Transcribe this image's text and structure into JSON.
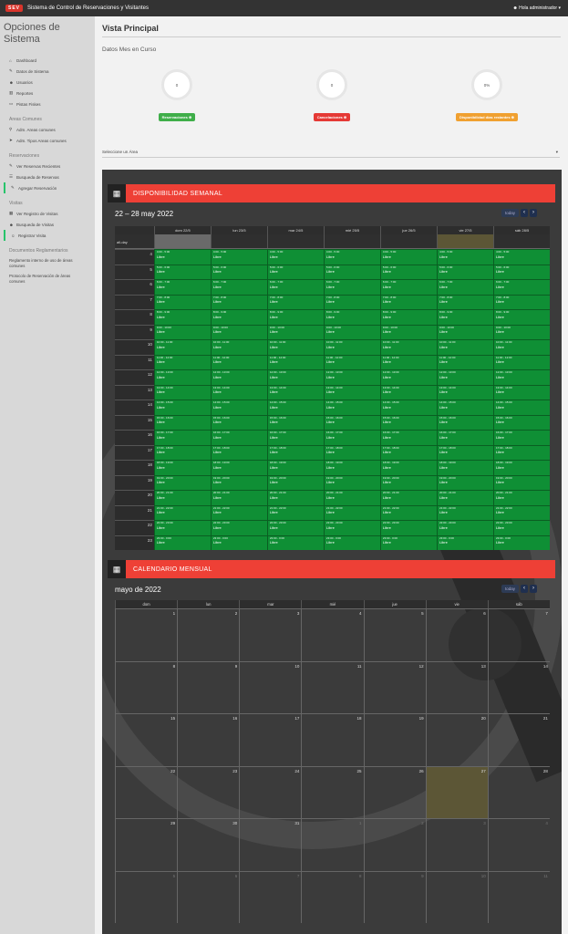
{
  "navbar": {
    "logo": "SEV",
    "title": "Sistema de Control de Reservaciones y Visitantes",
    "user": "Hola administrador ▾"
  },
  "sidebar": {
    "title": "Opciones de Sistema",
    "items": [
      {
        "icon": "home-icon",
        "glyph": "⌂",
        "label": "Dashboard"
      },
      {
        "icon": "edit-icon",
        "glyph": "✎",
        "label": "Datos de Sistema"
      },
      {
        "icon": "users-icon",
        "glyph": "☻",
        "label": "Usuarios"
      },
      {
        "icon": "chart-icon",
        "glyph": "▥",
        "label": "Reportes"
      },
      {
        "icon": "tv-icon",
        "glyph": "▭",
        "label": "Pistas Fiskes"
      }
    ],
    "sections": [
      {
        "title": "Areas Comunes",
        "items": [
          {
            "icon": "pin-icon",
            "glyph": "⚲",
            "label": "Adm. Areas comunes"
          },
          {
            "icon": "arrow-icon",
            "glyph": "➤",
            "label": "Adm. Tipos Areas comunes"
          }
        ]
      },
      {
        "title": "Reservaciones",
        "items": [
          {
            "icon": "edit-icon",
            "glyph": "✎",
            "label": "Ver Reservas Recientes"
          },
          {
            "icon": "list-icon",
            "glyph": "☰",
            "label": "Busqueda de Reservas"
          },
          {
            "icon": "edit-icon",
            "glyph": "✎",
            "label": "Agregar Reservación",
            "active": true
          }
        ]
      },
      {
        "title": "Visitas",
        "items": [
          {
            "icon": "calendar-icon",
            "glyph": "▦",
            "label": "Ver Registro de Visitas"
          },
          {
            "icon": "user-icon",
            "glyph": "☻",
            "label": "Busqueda de Visitas"
          },
          {
            "icon": "user-add-icon",
            "glyph": "☺",
            "label": "Registrar Visita",
            "active": true
          }
        ]
      }
    ],
    "docs_title": "Documentos Reglamentarios",
    "docs": [
      "Reglamento interno de uso de áreas comunes",
      "Protocolo de Reservación de áreas comunes"
    ]
  },
  "main": {
    "title": "Vista Principal",
    "stats_title": "Datos Mes en Curso",
    "stats": [
      {
        "value": "0",
        "badge": "Reservaciones ⊕",
        "color": "#3fae49"
      },
      {
        "value": "0",
        "badge": "Cancelaciones ⊕",
        "color": "#e53935"
      },
      {
        "value": "0%",
        "badge": "Disponibilidad días restantes ⊕",
        "color": "#f0a030"
      }
    ],
    "area_select": "Seleccione un Área"
  },
  "weekly": {
    "header": "DISPONIBILIDAD SEMANAL",
    "range": "22 – 28 may 2022",
    "today": "today",
    "prev": "‹",
    "next": "›",
    "all_day": "all-day",
    "days": [
      "dom 22/5",
      "lun 23/5",
      "mar 24/5",
      "mié 25/5",
      "jue 26/5",
      "vie 27/5",
      "sáb 28/5"
    ],
    "hours": [
      "4",
      "5",
      "6",
      "7",
      "8",
      "9",
      "10",
      "11",
      "12",
      "13",
      "14",
      "15",
      "16",
      "17",
      "18",
      "19",
      "20",
      "21",
      "22",
      "23"
    ],
    "slots": [
      "4:00 - 5:00",
      "5:00 - 6:00",
      "6:00 - 7:00",
      "7:00 - 8:00",
      "8:00 - 9:00",
      "9:00 - 10:00",
      "10:00 - 11:00",
      "11:00 - 12:00",
      "12:00 - 13:00",
      "13:00 - 14:00",
      "14:00 - 15:00",
      "15:00 - 16:00",
      "16:00 - 17:00",
      "17:00 - 18:00",
      "18:00 - 19:00",
      "19:00 - 20:00",
      "20:00 - 21:00",
      "21:00 - 22:00",
      "22:00 - 23:00",
      "23:00 - 0:00"
    ],
    "event_label": "Libre"
  },
  "monthly": {
    "header": "CALENDARIO MENSUAL",
    "title": "mayo de 2022",
    "today": "today",
    "prev": "‹",
    "next": "›",
    "days": [
      "dom",
      "lun",
      "mar",
      "mié",
      "jue",
      "vie",
      "sáb"
    ],
    "weeks": [
      [
        "1",
        "2",
        "3",
        "4",
        "5",
        "6",
        "7"
      ],
      [
        "8",
        "9",
        "10",
        "11",
        "12",
        "13",
        "14"
      ],
      [
        "15",
        "16",
        "17",
        "18",
        "19",
        "20",
        "21"
      ],
      [
        "22",
        "23",
        "24",
        "25",
        "26",
        "27",
        "28"
      ],
      [
        "29",
        "30",
        "31",
        "1",
        "2",
        "3",
        "4"
      ],
      [
        "5",
        "6",
        "7",
        "8",
        "9",
        "10",
        "11"
      ]
    ],
    "today_date": "27"
  }
}
